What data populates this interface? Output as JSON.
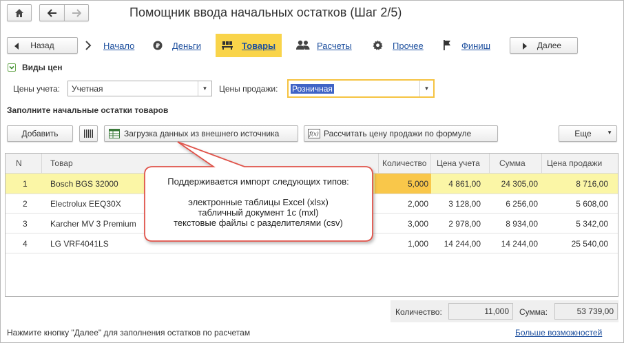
{
  "window": {
    "title": "Помощник ввода начальных остатков (Шаг 2/5)"
  },
  "nav": {
    "back_label": "Назад",
    "next_label": "Далее",
    "steps": [
      {
        "label": "Начало",
        "icon": "chevron-right-icon",
        "active": false
      },
      {
        "label": "Деньги",
        "icon": "money-icon",
        "active": false
      },
      {
        "label": "Товары",
        "icon": "goods-icon",
        "active": true
      },
      {
        "label": "Расчеты",
        "icon": "people-icon",
        "active": false
      },
      {
        "label": "Прочее",
        "icon": "gear-icon",
        "active": false
      },
      {
        "label": "Финиш",
        "icon": "flag-icon",
        "active": false
      }
    ]
  },
  "prices": {
    "section_title": "Виды цен",
    "accounting_label": "Цены учета:",
    "accounting_value": "Учетная",
    "sale_label": "Цены продажи:",
    "sale_value": "Розничная"
  },
  "goods": {
    "section_title": "Заполните начальные остатки товаров",
    "add_label": "Добавить",
    "import_label": "Загрузка данных из внешнего источника",
    "calc_label": "Рассчитать цену продажи по формуле",
    "more_label": "Еще"
  },
  "table": {
    "columns": [
      "N",
      "Товар",
      "Количество",
      "Цена учета",
      "Сумма",
      "Цена продажи"
    ],
    "rows": [
      {
        "n": "1",
        "product": "Bosch BGS 32000",
        "qty": "5,000",
        "cost": "4 861,00",
        "sum": "24 305,00",
        "price": "8 716,00"
      },
      {
        "n": "2",
        "product": "Electrolux EEQ30X",
        "qty": "2,000",
        "cost": "3 128,00",
        "sum": "6 256,00",
        "price": "5 608,00"
      },
      {
        "n": "3",
        "product": "Karcher MV 3 Premium",
        "qty": "3,000",
        "cost": "2 978,00",
        "sum": "8 934,00",
        "price": "5 342,00"
      },
      {
        "n": "4",
        "product": "LG VRF4041LS",
        "qty": "1,000",
        "cost": "14 244,00",
        "sum": "14 244,00",
        "price": "25 540,00"
      }
    ]
  },
  "totals": {
    "qty_label": "Количество:",
    "qty_value": "11,000",
    "sum_label": "Сумма:",
    "sum_value": "53 739,00"
  },
  "callout": {
    "line1": "Поддерживается импорт следующих типов:",
    "line2": "электронные таблицы Excel (xlsx)",
    "line3": "табличный документ 1с (mxl)",
    "line4": "текстовые файлы с разделителями (csv)"
  },
  "footer": {
    "hint": "Нажмите кнопку \"Далее\" для заполнения остатков по расчетам",
    "more_link": "Больше возможностей"
  },
  "colors": {
    "accent_yellow": "#f9d44a",
    "selected_row": "#fbf6a6",
    "link_blue": "#1d4f9e",
    "callout_border": "#e0524a",
    "focus_border": "#f5c341"
  }
}
